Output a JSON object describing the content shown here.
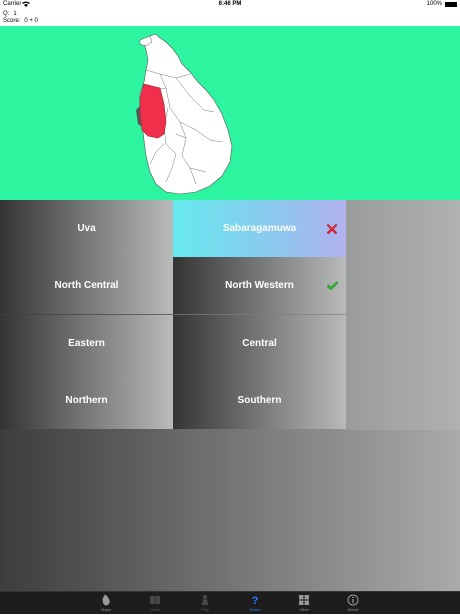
{
  "status_bar": {
    "carrier": "Carrier",
    "time": "6:46 PM",
    "battery": "100%"
  },
  "score_header": {
    "q_label": "Q:",
    "q_value": "1",
    "score_label": "Score:",
    "score_value": "0 + 0"
  },
  "colors": {
    "map_background": "#2df59f",
    "highlight_region": "#f0304a",
    "wrong_tile": "#8dc8ee",
    "active_tab": "#1f7fff"
  },
  "answers": [
    {
      "label": "Uva",
      "state": "normal"
    },
    {
      "label": "Sabaragamuwa",
      "state": "wrong",
      "icon": "cross-icon"
    },
    {
      "label": "North Central",
      "state": "normal"
    },
    {
      "label": "North Western",
      "state": "correct",
      "icon": "checkmark-icon"
    },
    {
      "label": "Eastern",
      "state": "normal"
    },
    {
      "label": "Central",
      "state": "normal"
    },
    {
      "label": "Northern",
      "state": "normal"
    },
    {
      "label": "Southern",
      "state": "normal"
    }
  ],
  "tab_bar": {
    "items": [
      {
        "label": "Maps",
        "icon": "map-outline-icon",
        "state": "normal"
      },
      {
        "label": "Learn",
        "icon": "book-icon",
        "state": "dim"
      },
      {
        "label": "Play",
        "icon": "pawn-icon",
        "state": "dim"
      },
      {
        "label": "Game",
        "icon": "question-icon",
        "state": "active"
      },
      {
        "label": "Other",
        "icon": "grid-icon",
        "state": "normal"
      },
      {
        "label": "About",
        "icon": "info-icon",
        "state": "normal"
      }
    ]
  }
}
